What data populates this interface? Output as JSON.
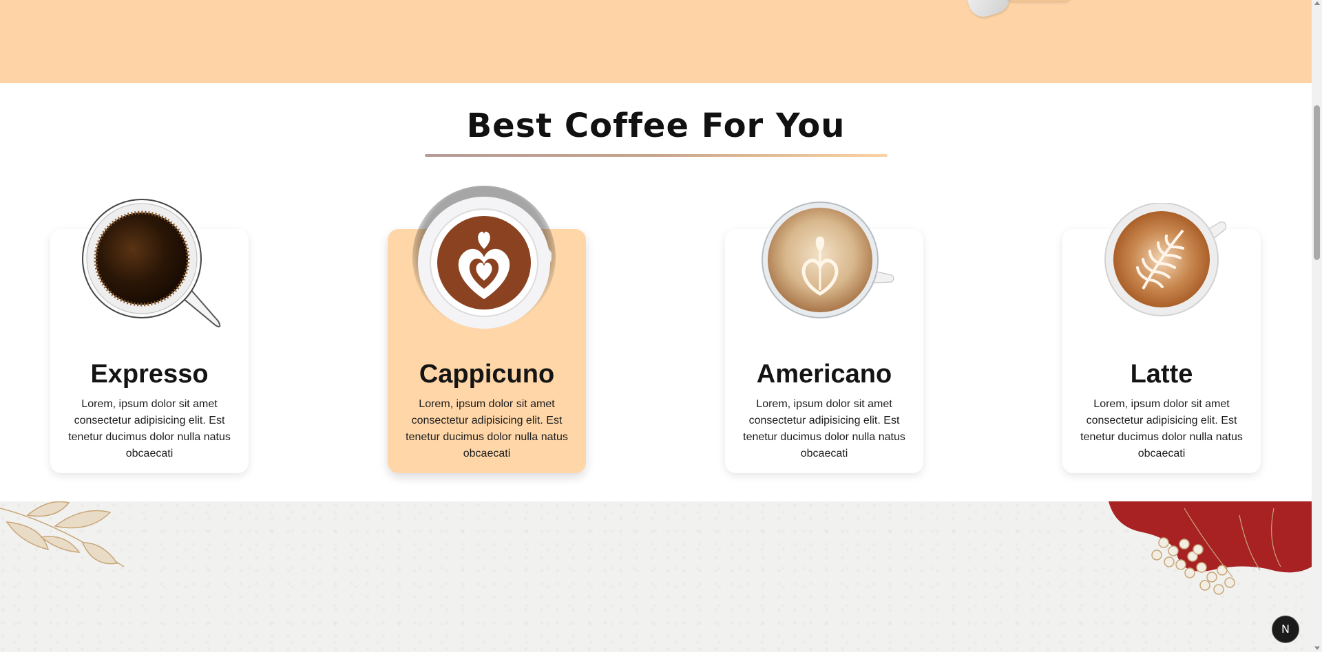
{
  "section": {
    "title": "Best Coffee For You"
  },
  "cards": [
    {
      "name": "Expresso",
      "description": "Lorem, ipsum dolor sit amet consectetur adipisicing elit. Est tenetur ducimus dolor nulla natus obcaecati",
      "active": false
    },
    {
      "name": "Cappicuno",
      "description": "Lorem, ipsum dolor sit amet consectetur adipisicing elit. Est tenetur ducimus dolor nulla natus obcaecati",
      "active": true
    },
    {
      "name": "Americano",
      "description": "Lorem, ipsum dolor sit amet consectetur adipisicing elit. Est tenetur ducimus dolor nulla natus obcaecati",
      "active": false
    },
    {
      "name": "Latte",
      "description": "Lorem, ipsum dolor sit amet consectetur adipisicing elit. Est tenetur ducimus dolor nulla natus obcaecati",
      "active": false
    }
  ],
  "badge": {
    "label": "N"
  },
  "colors": {
    "hero_band": "#fed4a6",
    "active_card": "#fed6a8",
    "accent_red": "#a82224",
    "leaf_tan": "#c9a679"
  },
  "icons": {
    "cards": [
      "espresso-cup-icon",
      "cappuccino-cup-icon",
      "americano-cup-icon",
      "latte-cup-icon"
    ],
    "decor": [
      "leaf-branch-icon",
      "berry-flower-icon"
    ]
  }
}
